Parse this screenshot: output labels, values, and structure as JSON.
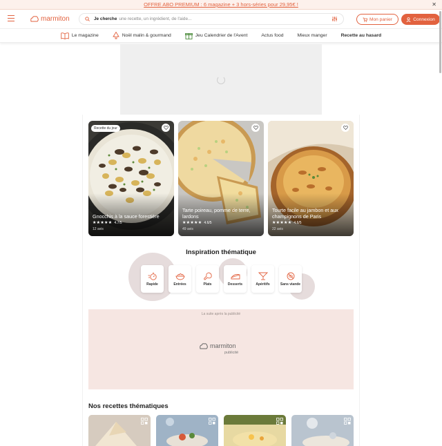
{
  "promo": {
    "text": "OFFRE ABO PREMIUM : 6 magazine + 3 hors-séries pour 29,95€ !",
    "close": "✕"
  },
  "header": {
    "logo": "marmiton",
    "search_label": "Je cherche",
    "search_placeholder": "une recette, un ingrédient, de l'aide...",
    "panier": "Mon panier",
    "connexion": "Connexion"
  },
  "nav": {
    "items": [
      "Le magazine",
      "Noël malin & gourmand",
      "Jeu Calendrier de l'Avent",
      "Actus food",
      "Mieux manger",
      "Recette au hasard"
    ]
  },
  "recipes": [
    {
      "badge": "Recette du jour",
      "title": "Gnocchis à la sauce forestière",
      "rating": "4.7/5",
      "rating_value": 4.7,
      "avis": "12 avis"
    },
    {
      "title": "Tarte poireau, pomme de terre, lardons",
      "rating": "4.6/5",
      "rating_value": 4.6,
      "avis": "49 avis"
    },
    {
      "title": "Tourte facile au jambon et aux champignons de Paris",
      "rating": "4.6/5",
      "rating_value": 4.6,
      "avis": "22 avis"
    }
  ],
  "inspiration": {
    "title": "Inspiration thématique",
    "categories": [
      "Rapide",
      "Entrées",
      "Plats",
      "Desserts",
      "Apéritifs",
      "Sans viande"
    ]
  },
  "ad": {
    "suite": "La suite après la publicité",
    "logo": "marmiton",
    "sub": "publicité"
  },
  "thematic": {
    "title": "Nos recettes thématiques"
  },
  "colors": {
    "accent": "#e2623f",
    "ad_bg": "#f6e6e2",
    "blob": "#e6dcdc"
  }
}
